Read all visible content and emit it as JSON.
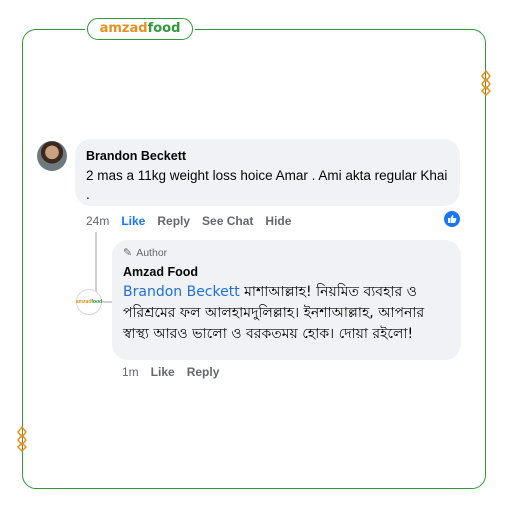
{
  "brand": {
    "part1": "amzad",
    "part2": "food"
  },
  "comment": {
    "author": "Brandon Beckett",
    "text": "2 mas a 11kg weight loss hoice Amar . Ami akta regular Khai .",
    "time": "24m",
    "actions": [
      "Like",
      "Reply",
      "See Chat",
      "Hide"
    ]
  },
  "reply": {
    "badge": "Author",
    "author": "Amzad Food",
    "mention": "Brandon Beckett",
    "text": " মাশাআল্লাহ! নিয়মিত ব্যবহার ও পরিশ্রমের ফল আলহামদুলিল্লাহ। ইনশাআল্লাহ, আপনার স্বাস্থ্য আরও ভালো ও বরকতময় হোক। দোয়া রইলো!",
    "time": "1m",
    "actions": [
      "Like",
      "Reply"
    ]
  },
  "icons": {
    "like_badge": "thumbs-up-icon",
    "author_badge": "pencil-icon",
    "chains": "chain-ornament-icon"
  },
  "colors": {
    "frame": "#2e9b3a",
    "brand_orange": "#e8901f",
    "link_blue": "#1877f2",
    "bubble": "#f0f2f5"
  }
}
